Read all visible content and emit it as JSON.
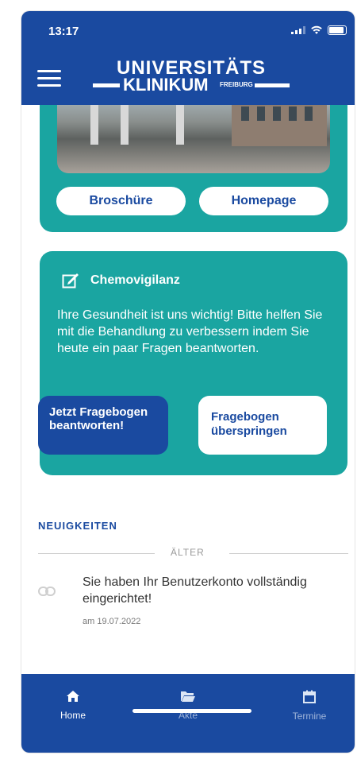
{
  "status_bar": {
    "time": "13:17"
  },
  "header": {
    "logo_top": "UNIVERSITÄTS",
    "logo_bottom": "KLINIKUM",
    "logo_small": "FREIBURG"
  },
  "card_info": {
    "buttons": [
      {
        "label": "Broschüre"
      },
      {
        "label": "Homepage"
      }
    ]
  },
  "chemovigilanz": {
    "title": "Chemovigilanz",
    "text": "Ihre Gesundheit ist uns wichtig! Bitte helfen Sie mit die Behandlung zu verbessern indem Sie heute ein paar Fragen beantworten.",
    "primary_button": "Jetzt Fragebogen beantworten!",
    "secondary_button": "Fragebogen überspringen"
  },
  "news": {
    "heading": "NEUIGKEITEN",
    "divider_label": "ÄLTER",
    "items": [
      {
        "text": "Sie haben Ihr Benutzerkonto vollständig eingerichtet!",
        "date": "am 19.07.2022"
      }
    ]
  },
  "tabbar": {
    "tabs": [
      {
        "label": "Home",
        "icon": "home-icon",
        "active": true
      },
      {
        "label": "Akte",
        "icon": "folder-icon",
        "active": false
      },
      {
        "label": "Termine",
        "icon": "calendar-icon",
        "active": false
      }
    ]
  },
  "colors": {
    "primary": "#1a4aa0",
    "teal": "#1aa5a1",
    "background": "#ffffff"
  }
}
